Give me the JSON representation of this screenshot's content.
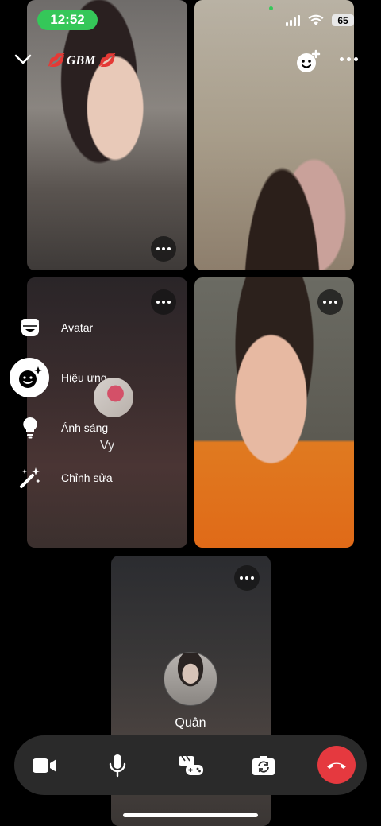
{
  "status_bar": {
    "time": "12:52",
    "battery": "65"
  },
  "header": {
    "title": "💋 GBM 💋"
  },
  "side_menu": {
    "items": [
      {
        "label": "Avatar",
        "icon": "avatar-icon"
      },
      {
        "label": "Hiệu ứng",
        "icon": "effects-icon"
      },
      {
        "label": "Ánh sáng",
        "icon": "lightbulb-icon"
      },
      {
        "label": "Chỉnh sửa",
        "icon": "magic-wand-icon"
      }
    ]
  },
  "participants": [
    {
      "name": "",
      "tile": "video"
    },
    {
      "name": "",
      "tile": "video"
    },
    {
      "name": "Vy",
      "tile": "avatar"
    },
    {
      "name": "",
      "tile": "video"
    },
    {
      "name": "Quân",
      "tile": "avatar"
    }
  ],
  "controls": {
    "items": [
      "video-camera-icon",
      "microphone-icon",
      "games-icon",
      "flip-camera-icon",
      "end-call-icon"
    ],
    "end_call_color": "#e5393f"
  },
  "colors": {
    "status_time_bg": "#35c759",
    "background": "#000000"
  }
}
